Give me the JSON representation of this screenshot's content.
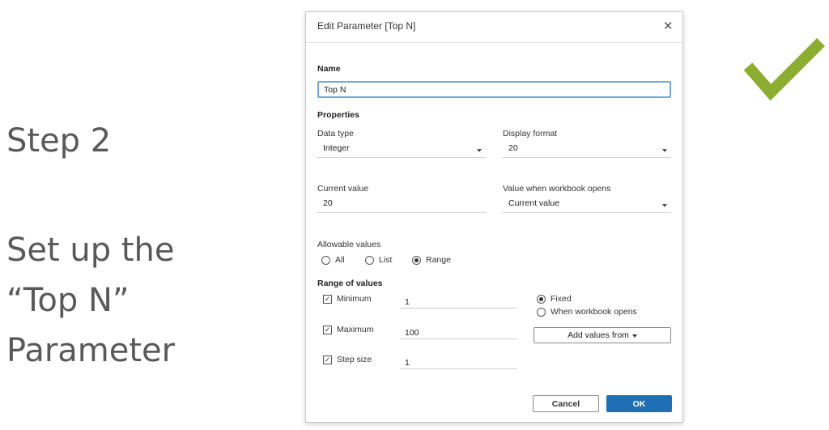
{
  "slide": {
    "step": "Step 2",
    "description_lines": [
      "Set up the",
      "“Top N”",
      "Parameter"
    ]
  },
  "colors": {
    "check": "#8cad2f",
    "primary_button": "#1f6fb4",
    "focus_border": "#6fa8dc"
  },
  "dialog": {
    "title": "Edit Parameter [Top N]",
    "name_section": "Name",
    "name_value": "Top N",
    "properties_section": "Properties",
    "data_type_label": "Data type",
    "data_type_value": "Integer",
    "display_format_label": "Display format",
    "display_format_value": "20",
    "current_value_label": "Current value",
    "current_value": "20",
    "workbook_opens_label": "Value when workbook opens",
    "workbook_opens_value": "Current value",
    "allowable_label": "Allowable values",
    "allowable_options": {
      "all": "All",
      "list": "List",
      "range": "Range",
      "selected": "Range"
    },
    "range_section": "Range of values",
    "minimum": {
      "label": "Minimum",
      "checked": true,
      "value": "1"
    },
    "maximum": {
      "label": "Maximum",
      "checked": true,
      "value": "100"
    },
    "step_size": {
      "label": "Step size",
      "checked": true,
      "value": "1"
    },
    "range_mode": {
      "fixed": "Fixed",
      "when_opens": "When workbook opens",
      "selected": "Fixed"
    },
    "add_values_label": "Add values from",
    "cancel_label": "Cancel",
    "ok_label": "OK"
  }
}
